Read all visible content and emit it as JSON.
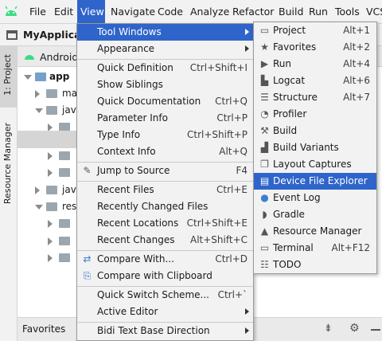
{
  "menubar": {
    "items": [
      "File",
      "Edit",
      "View",
      "Navigate",
      "Code",
      "Analyze",
      "Refactor",
      "Build",
      "Run",
      "Tools",
      "VCS"
    ],
    "active": "View"
  },
  "toolbar": {
    "project_name": "MyApplicatio"
  },
  "left_strip": {
    "project_tab": "1: Project",
    "resource_tab": "Resource Manager"
  },
  "panel": {
    "header": "Android",
    "tree": [
      {
        "label": "app"
      },
      {
        "label": "ma"
      },
      {
        "label": "java"
      },
      {
        "label": ""
      },
      {
        "label": ""
      },
      {
        "label": ""
      },
      {
        "label": "java"
      },
      {
        "label": "res"
      },
      {
        "label": ""
      },
      {
        "label": ""
      },
      {
        "label": ""
      }
    ]
  },
  "bottom": {
    "favorites": "Favorites"
  },
  "view_menu": {
    "items": [
      {
        "label": "Tool Windows",
        "mn": "T",
        "rest": "ool Windows",
        "submenu": true
      },
      {
        "label": "Appearance",
        "submenu": true
      },
      {
        "label": "Quick Definition",
        "shortcut": "Ctrl+Shift+I"
      },
      {
        "label": "Show Siblings",
        "shortcut": ""
      },
      {
        "label": "Quick Documentation",
        "shortcut": "Ctrl+Q"
      },
      {
        "label": "Parameter Info",
        "shortcut": "Ctrl+P"
      },
      {
        "label": "Type Info",
        "shortcut": "Ctrl+Shift+P"
      },
      {
        "label": "Context Info",
        "shortcut": "Alt+Q"
      },
      {
        "label": "Jump to Source",
        "shortcut": "F4"
      },
      {
        "label": "Recent Files",
        "shortcut": "Ctrl+E"
      },
      {
        "label": "Recently Changed Files",
        "shortcut": ""
      },
      {
        "label": "Recent Locations",
        "shortcut": "Ctrl+Shift+E"
      },
      {
        "label": "Recent Changes",
        "shortcut": "Alt+Shift+C"
      },
      {
        "label": "Compare With...",
        "shortcut": "Ctrl+D"
      },
      {
        "label": "Compare with Clipboard",
        "shortcut": ""
      },
      {
        "label": "Quick Switch Scheme...",
        "shortcut": "Ctrl+`"
      },
      {
        "label": "Active Editor",
        "submenu": true
      },
      {
        "label": "Bidi Text Base Direction",
        "submenu": true
      }
    ]
  },
  "tool_windows_menu": {
    "items": [
      {
        "label": "Project",
        "shortcut": "Alt+1",
        "icon": "project-icon"
      },
      {
        "label": "Favorites",
        "shortcut": "Alt+2",
        "icon": "star-icon"
      },
      {
        "label": "Run",
        "shortcut": "Alt+4",
        "icon": "run-icon"
      },
      {
        "label": "Logcat",
        "shortcut": "Alt+6",
        "icon": "logcat-icon"
      },
      {
        "label": "Structure",
        "shortcut": "Alt+7",
        "icon": "structure-icon"
      },
      {
        "label": "Profiler",
        "shortcut": "",
        "icon": "profiler-icon"
      },
      {
        "label": "Build",
        "shortcut": "",
        "icon": "build-icon"
      },
      {
        "label": "Build Variants",
        "shortcut": "",
        "icon": "build-variants-icon"
      },
      {
        "label": "Layout Captures",
        "shortcut": "",
        "icon": "layout-captures-icon"
      },
      {
        "label": "Device File Explorer",
        "shortcut": "",
        "icon": "device-file-explorer-icon",
        "highlighted": true
      },
      {
        "label": "Event Log",
        "shortcut": "",
        "icon": "event-log-icon"
      },
      {
        "label": "Gradle",
        "shortcut": "",
        "icon": "gradle-icon"
      },
      {
        "label": "Resource Manager",
        "shortcut": "",
        "icon": "resource-manager-icon"
      },
      {
        "label": "Terminal",
        "shortcut": "Alt+F12",
        "icon": "terminal-icon"
      },
      {
        "label": "TODO",
        "shortcut": "",
        "icon": "todo-icon"
      }
    ]
  },
  "colors": {
    "highlight": "#2f65ca",
    "android_green": "#3ddc84",
    "menu_bg": "#f2f2f2"
  }
}
